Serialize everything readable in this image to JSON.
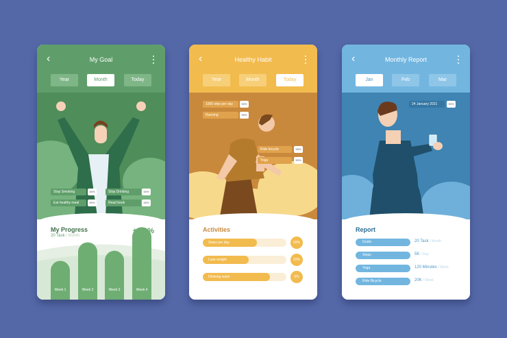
{
  "colors": {
    "background": "#5468a8",
    "green": "#5f9e6a",
    "orange": "#f2bb4e",
    "blue": "#72b6e0"
  },
  "goal": {
    "title": "My Goal",
    "tabs": [
      "Year",
      "Month",
      "Today"
    ],
    "active_tab": "Month",
    "habits": [
      {
        "label": "Stop Smoking",
        "pct": "50%"
      },
      {
        "label": "Stop Drinking",
        "pct": "50%"
      },
      {
        "label": "Eat healthy meal",
        "pct": "50%"
      },
      {
        "label": "Read book",
        "pct": "50%"
      }
    ],
    "progress_title": "My Progress",
    "progress_tasks": "20 Task",
    "progress_period": "/ Month",
    "progress_change": "+ 50%",
    "weeks": [
      {
        "label": "Week 1",
        "value": 0.23
      },
      {
        "label": "Week 2",
        "value": 0.34
      },
      {
        "label": "Week 3",
        "value": 0.29
      },
      {
        "label": "Week 4",
        "value": 0.43
      }
    ]
  },
  "habit": {
    "title": "Healthy Habit",
    "tabs": [
      "Year",
      "Month",
      "Today"
    ],
    "active_tab": "Today",
    "top_items": [
      {
        "label": "1000 step per day",
        "pct": "50%"
      },
      {
        "label": "Running",
        "pct": "50%"
      }
    ],
    "side_items": [
      {
        "label": "Ride bicycle",
        "pct": "50%"
      },
      {
        "label": "Yoga",
        "pct": "50%"
      }
    ],
    "activities_title": "Activities",
    "activities": [
      {
        "label": "Steps per day",
        "value": 0.65,
        "pct": "60%"
      },
      {
        "label": "Lose weight",
        "value": 0.55,
        "pct": "10%"
      },
      {
        "label": "Drinking water",
        "value": 0.8,
        "pct": "5%"
      }
    ]
  },
  "report": {
    "title": "Monthly Report",
    "tabs": [
      "Jan",
      "Feb",
      "Mar"
    ],
    "active_tab": "Jan",
    "date_label": "24 January 2021",
    "date_pct": "50%",
    "report_title": "Report",
    "rows": [
      {
        "label": "Goals",
        "value": "20 Task",
        "unit": "/ Month"
      },
      {
        "label": "Steps",
        "value": "5K",
        "unit": "/ Day"
      },
      {
        "label": "Yoga",
        "value": "120 Minutes",
        "unit": "/ Week"
      },
      {
        "label": "Ride Bicycle",
        "value": "20K",
        "unit": "/ Week"
      }
    ]
  }
}
